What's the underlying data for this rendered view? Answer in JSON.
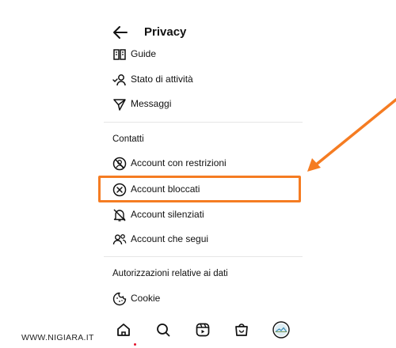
{
  "header": {
    "title": "Privacy"
  },
  "items_top": [
    {
      "label": "Guide",
      "icon": "guide-book-icon"
    },
    {
      "label": "Stato di attività",
      "icon": "activity-status-icon"
    },
    {
      "label": "Messaggi",
      "icon": "messages-send-icon"
    }
  ],
  "contacts": {
    "heading": "Contatti",
    "items": [
      {
        "label": "Account con restrizioni",
        "icon": "restricted-icon"
      },
      {
        "label": "Account bloccati",
        "icon": "blocked-icon"
      },
      {
        "label": "Account silenziati",
        "icon": "muted-bell-icon"
      },
      {
        "label": "Account che segui",
        "icon": "following-icon"
      }
    ]
  },
  "data_permissions": {
    "heading": "Autorizzazioni relative ai dati",
    "items": [
      {
        "label": "Cookie",
        "icon": "cookie-icon"
      }
    ]
  },
  "bottom_nav": [
    "home-icon",
    "search-icon",
    "reels-icon",
    "shop-icon",
    "profile-avatar"
  ],
  "highlight_color": "#f57c22",
  "watermark": "WWW.NIGIARA.IT"
}
